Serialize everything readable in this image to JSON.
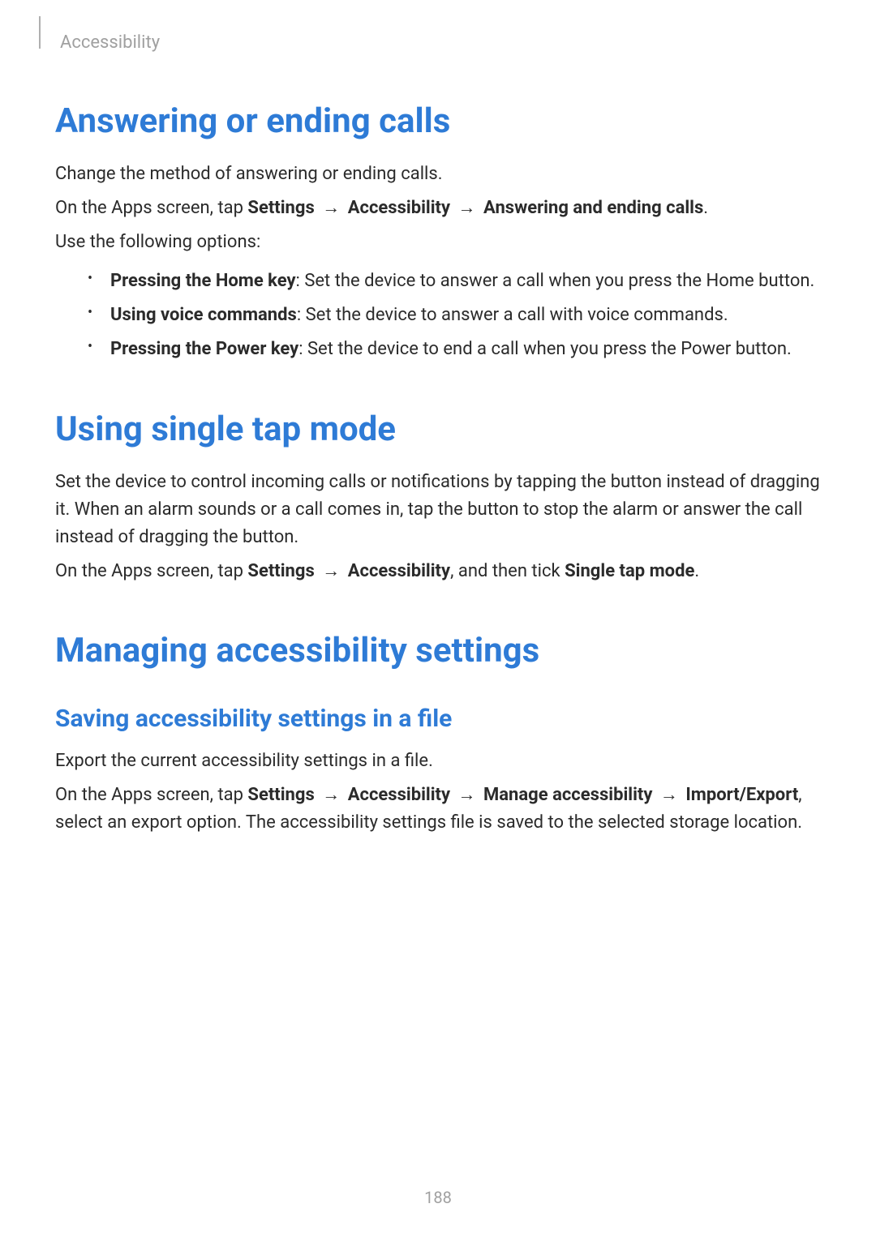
{
  "breadcrumb": "Accessibility",
  "page_number": "188",
  "arrow": "→",
  "sections": {
    "answering": {
      "title": "Answering or ending calls",
      "intro": "Change the method of answering or ending calls.",
      "nav_prefix": "On the Apps screen, tap ",
      "nav_settings": "Settings",
      "nav_accessibility": "Accessibility",
      "nav_target": "Answering and ending calls",
      "nav_suffix": ".",
      "options_label": "Use the following options:",
      "items": [
        {
          "label": "Pressing the Home key",
          "desc": ": Set the device to answer a call when you press the Home button."
        },
        {
          "label": "Using voice commands",
          "desc": ": Set the device to answer a call with voice commands."
        },
        {
          "label": "Pressing the Power key",
          "desc": ": Set the device to end a call when you press the Power button."
        }
      ]
    },
    "singletap": {
      "title": "Using single tap mode",
      "intro": "Set the device to control incoming calls or notifications by tapping the button instead of dragging it. When an alarm sounds or a call comes in, tap the button to stop the alarm or answer the call instead of dragging the button.",
      "nav_prefix": "On the Apps screen, tap ",
      "nav_settings": "Settings",
      "nav_accessibility": "Accessibility",
      "nav_mid": ", and then tick ",
      "nav_target": "Single tap mode",
      "nav_suffix": "."
    },
    "managing": {
      "title": "Managing accessibility settings",
      "sub": {
        "title": "Saving accessibility settings in a file",
        "intro": "Export the current accessibility settings in a file.",
        "nav_prefix": "On the Apps screen, tap ",
        "nav_settings": "Settings",
        "nav_accessibility": "Accessibility",
        "nav_manage": "Manage accessibility",
        "nav_import": "Import/Export",
        "nav_suffix": ", select an export option. The accessibility settings file is saved to the selected storage location."
      }
    }
  }
}
